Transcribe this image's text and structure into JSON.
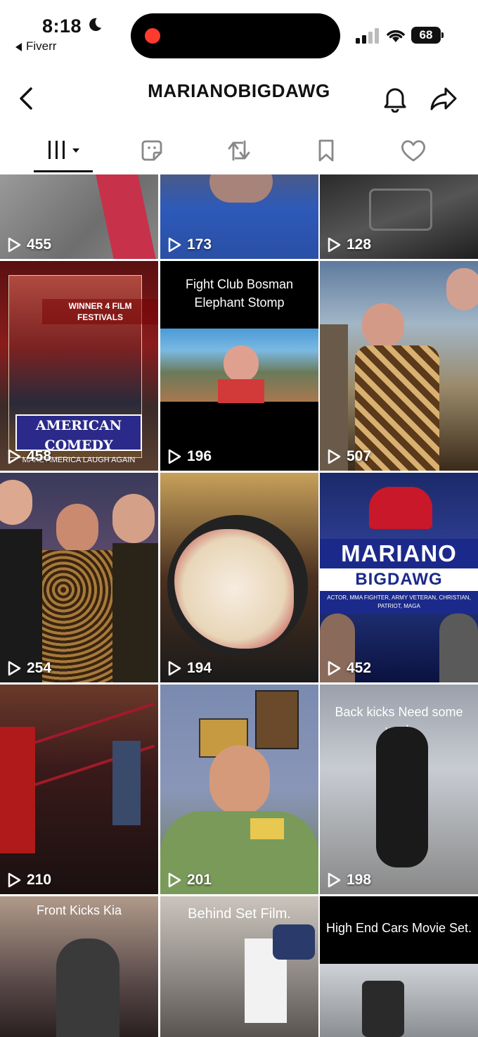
{
  "status_bar": {
    "time": "8:18",
    "back_app_label": "Fiverr",
    "battery": "68"
  },
  "header": {
    "title": "MARIANOBIGDAWG"
  },
  "tabs": [
    {
      "name": "videos",
      "icon": "grid-icon",
      "active": true
    },
    {
      "name": "stickers",
      "icon": "sticker-icon"
    },
    {
      "name": "reposts",
      "icon": "repost-icon"
    },
    {
      "name": "favorites",
      "icon": "bookmark-icon"
    },
    {
      "name": "liked",
      "icon": "heart-icon"
    }
  ],
  "watermark": "fiverr.",
  "videos": [
    {
      "views": "455"
    },
    {
      "views": "173"
    },
    {
      "views": "128"
    },
    {
      "views": "458",
      "poster_top": "WINNER 4 FILM FESTIVALS",
      "poster_title": "AMERICAN COMEDY",
      "poster_sub": "MAKE AMERICA LAUGH AGAIN"
    },
    {
      "views": "196",
      "caption": "Fight Club Bosman Elephant Stomp"
    },
    {
      "views": "507"
    },
    {
      "views": "254"
    },
    {
      "views": "194"
    },
    {
      "views": "452",
      "poster_line1": "MARIANO",
      "poster_line2": "BIGDAWG",
      "poster_line3": "ACTOR, MMA FIGHTER, ARMY VETERAN, CHRISTIAN, PATRIOT, MAGA"
    },
    {
      "views": "210"
    },
    {
      "views": "201"
    },
    {
      "views": "198",
      "caption": "Back kicks Need some work"
    },
    {
      "caption": "Front Kicks Kia"
    },
    {
      "caption": "Behind Set Film."
    },
    {
      "caption": "High End Cars Movie Set."
    }
  ],
  "colors": {
    "accent_red": "#ff3b30",
    "text": "#111111"
  }
}
